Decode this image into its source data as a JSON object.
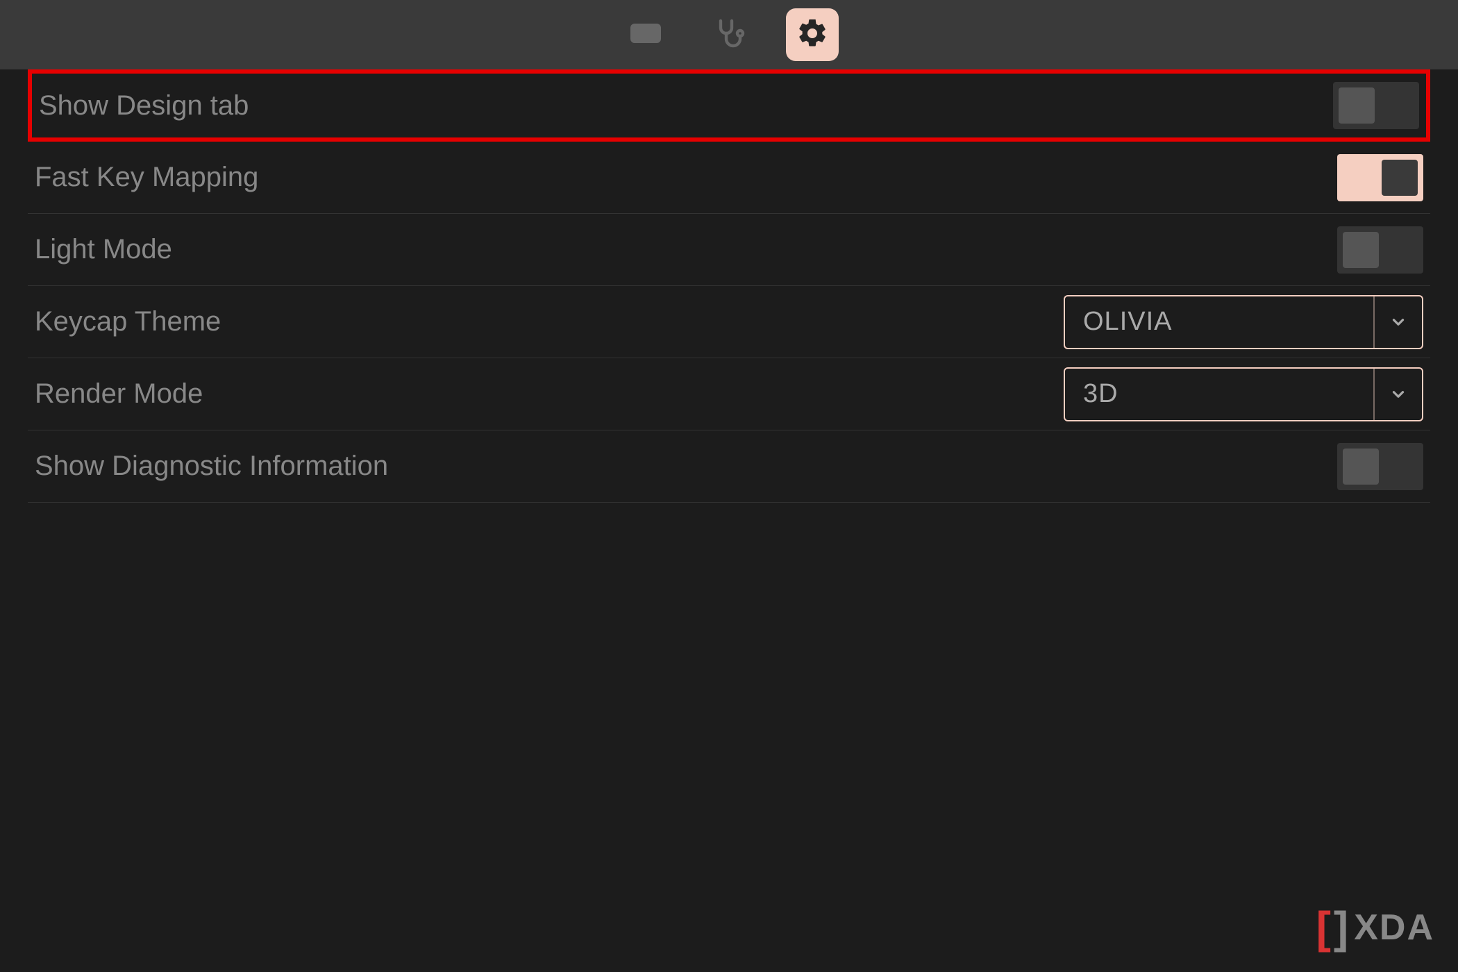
{
  "settings": {
    "show_design_tab": {
      "label": "Show Design tab",
      "value": false
    },
    "fast_key_mapping": {
      "label": "Fast Key Mapping",
      "value": true
    },
    "light_mode": {
      "label": "Light Mode",
      "value": false
    },
    "keycap_theme": {
      "label": "Keycap Theme",
      "value": "OLIVIA"
    },
    "render_mode": {
      "label": "Render Mode",
      "value": "3D"
    },
    "show_diagnostic": {
      "label": "Show Diagnostic Information",
      "value": false
    }
  },
  "toolbar": {
    "tabs": {
      "keyboard": "keyboard",
      "diagnostics": "diagnostics",
      "settings": "settings"
    },
    "active": "settings"
  },
  "watermark": {
    "text": "XDA"
  },
  "colors": {
    "accent": "#f5cfc1",
    "highlight_border": "#e60000",
    "background": "#1c1c1c",
    "toolbar_bg": "#3a3a3a"
  }
}
